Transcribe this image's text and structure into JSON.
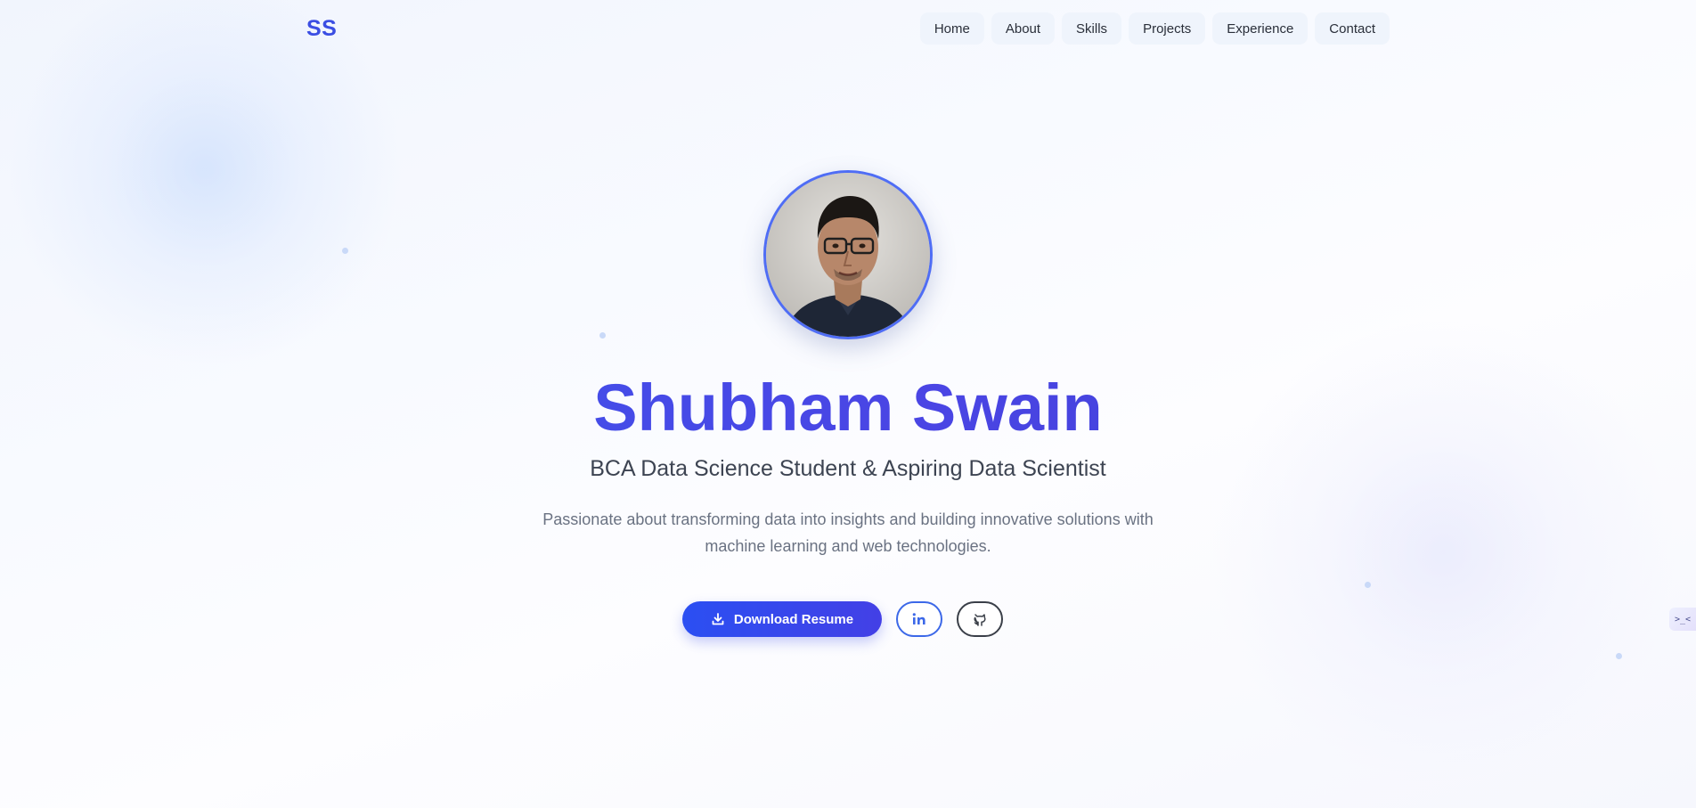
{
  "brand": {
    "logo_text": "SS"
  },
  "nav": {
    "items": [
      {
        "label": "Home"
      },
      {
        "label": "About"
      },
      {
        "label": "Skills"
      },
      {
        "label": "Projects"
      },
      {
        "label": "Experience"
      },
      {
        "label": "Contact"
      }
    ]
  },
  "hero": {
    "avatar_alt": "Profile photo of Shubham Swain",
    "name": "Shubham Swain",
    "subtitle": "BCA Data Science Student & Aspiring Data Scientist",
    "description": "Passionate about transforming data into insights and building innovative solutions with machine learning and web technologies.",
    "download_label": "Download Resume",
    "linkedin_icon": "linkedin-icon",
    "github_icon": "github-icon",
    "download_icon": "download-icon"
  },
  "colors": {
    "accent": "#3b4ee3",
    "primary_button": "#2b4ff2",
    "text_dark": "#2a2f3a",
    "text_muted": "#6a7282"
  },
  "side_widget": {
    "icon": "code-widget-icon"
  }
}
